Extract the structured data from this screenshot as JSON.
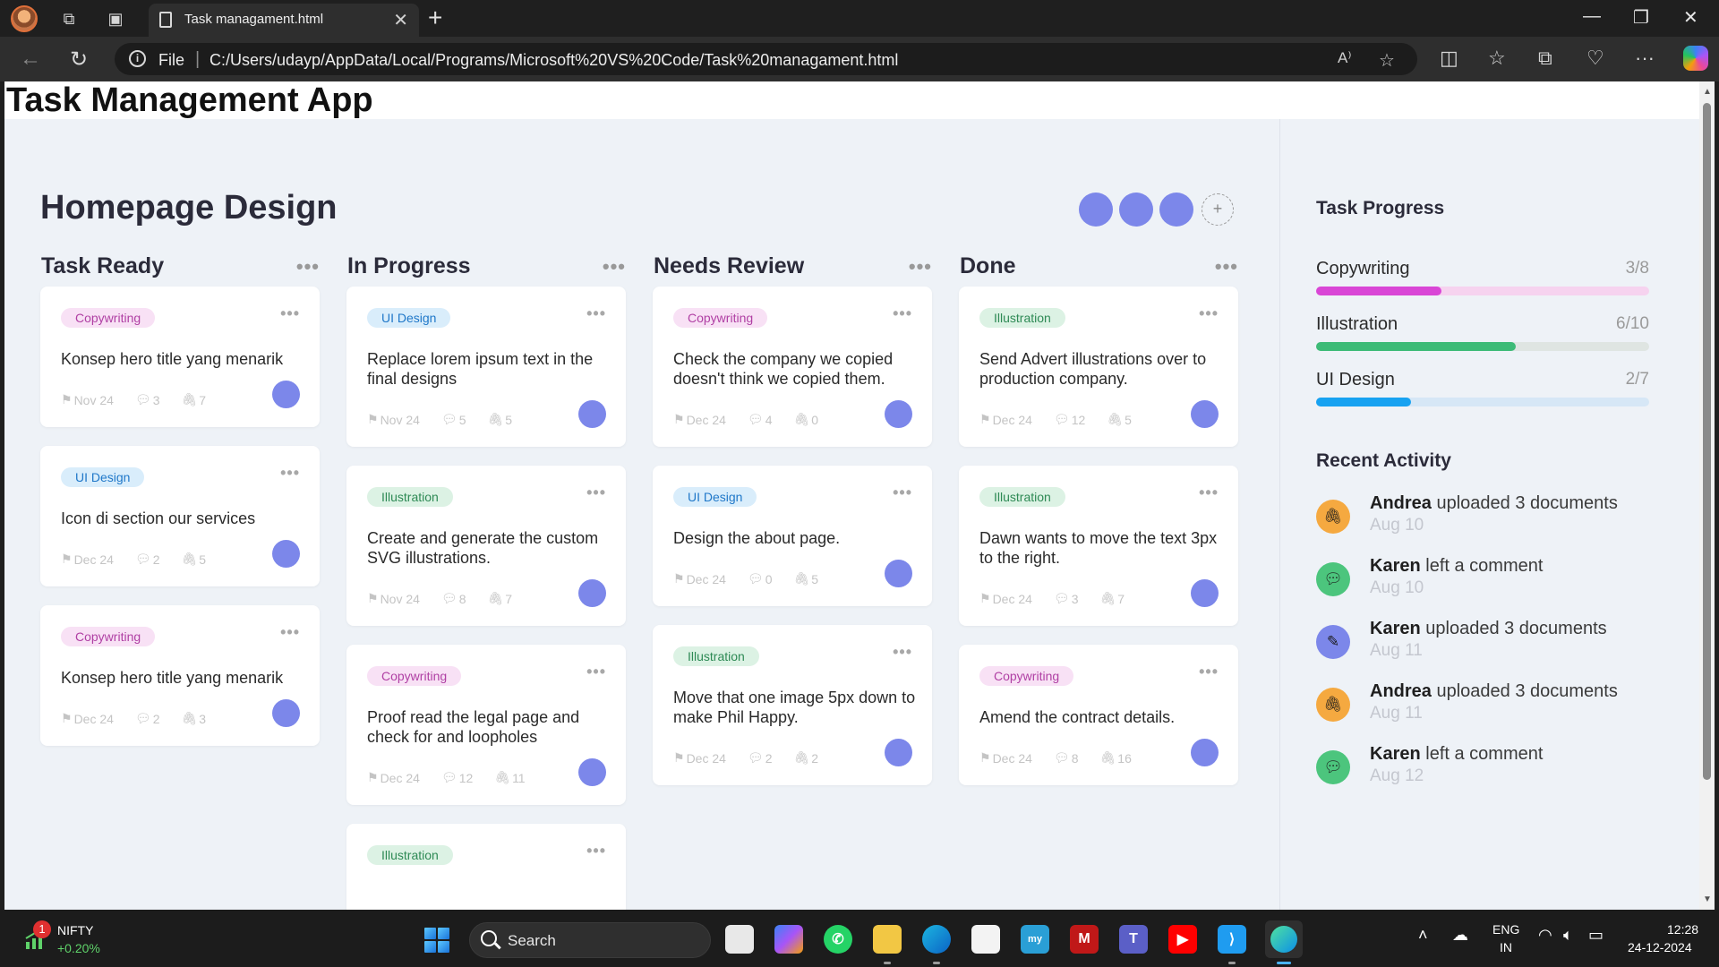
{
  "browser": {
    "tab_title": "Task managament.html",
    "url_scheme": "File",
    "url": "C:/Users/udayp/AppData/Local/Programs/Microsoft%20VS%20Code/Task%20managament.html"
  },
  "page": {
    "app_title": "Task Management App",
    "project_title": "Homepage Design",
    "add_member_label": "+"
  },
  "columns": [
    {
      "title": "Task Ready",
      "cards": [
        {
          "tag": "Copywriting",
          "tag_type": "copy",
          "title": "Konsep hero title yang menarik",
          "date": "Nov 24",
          "comments": "3",
          "attachments": "7"
        },
        {
          "tag": "UI Design",
          "tag_type": "ui",
          "title": "Icon di section our services",
          "date": "Dec 24",
          "comments": "2",
          "attachments": "5"
        },
        {
          "tag": "Copywriting",
          "tag_type": "copy",
          "title": "Konsep hero title yang menarik",
          "date": "Dec 24",
          "comments": "2",
          "attachments": "3"
        }
      ]
    },
    {
      "title": "In Progress",
      "cards": [
        {
          "tag": "UI Design",
          "tag_type": "ui",
          "title": "Replace lorem ipsum text in the final designs",
          "date": "Nov 24",
          "comments": "5",
          "attachments": "5"
        },
        {
          "tag": "Illustration",
          "tag_type": "ill",
          "title": "Create and generate the custom SVG illustrations.",
          "date": "Nov 24",
          "comments": "8",
          "attachments": "7"
        },
        {
          "tag": "Copywriting",
          "tag_type": "copy",
          "title": "Proof read the legal page and check for and loopholes",
          "date": "Dec 24",
          "comments": "12",
          "attachments": "11"
        },
        {
          "tag": "Illustration",
          "tag_type": "ill",
          "title": "",
          "date": "",
          "comments": "",
          "attachments": ""
        }
      ]
    },
    {
      "title": "Needs Review",
      "cards": [
        {
          "tag": "Copywriting",
          "tag_type": "copy",
          "title": "Check the company we copied doesn't think we copied them.",
          "date": "Dec 24",
          "comments": "4",
          "attachments": "0"
        },
        {
          "tag": "UI Design",
          "tag_type": "ui",
          "title": "Design the about page.",
          "date": "Dec 24",
          "comments": "0",
          "attachments": "5"
        },
        {
          "tag": "Illustration",
          "tag_type": "ill",
          "title": "Move that one image 5px down to make Phil Happy.",
          "date": "Dec 24",
          "comments": "2",
          "attachments": "2"
        }
      ]
    },
    {
      "title": "Done",
      "cards": [
        {
          "tag": "Illustration",
          "tag_type": "ill",
          "title": "Send Advert illustrations over to production company.",
          "date": "Dec 24",
          "comments": "12",
          "attachments": "5"
        },
        {
          "tag": "Illustration",
          "tag_type": "ill",
          "title": "Dawn wants to move the text 3px to the right.",
          "date": "Dec 24",
          "comments": "3",
          "attachments": "7"
        },
        {
          "tag": "Copywriting",
          "tag_type": "copy",
          "title": "Amend the contract details.",
          "date": "Dec 24",
          "comments": "8",
          "attachments": "16"
        }
      ]
    }
  ],
  "sidebar": {
    "progress_title": "Task Progress",
    "progress": [
      {
        "label": "Copywriting",
        "count": "3/8",
        "fraction": 0.375,
        "fill": "#d946d6",
        "track": "#f6d3ef"
      },
      {
        "label": "Illustration",
        "count": "6/10",
        "fraction": 0.6,
        "fill": "#3dbb77",
        "track": "#dfe5e2"
      },
      {
        "label": "UI Design",
        "count": "2/7",
        "fraction": 0.286,
        "fill": "#17a2f1",
        "track": "#d6e7f6"
      }
    ],
    "activity_title": "Recent Activity",
    "activity": [
      {
        "user": "Andrea",
        "action": "uploaded 3 documents",
        "date": "Aug 10",
        "icon": "paperclip-icon",
        "color": "#f5a940"
      },
      {
        "user": "Karen",
        "action": "left a comment",
        "date": "Aug 10",
        "icon": "comment-icon",
        "color": "#4cc57d"
      },
      {
        "user": "Karen",
        "action": "uploaded 3 documents",
        "date": "Aug 11",
        "icon": "pencil-icon",
        "color": "#7c87ea"
      },
      {
        "user": "Andrea",
        "action": "uploaded 3 documents",
        "date": "Aug 11",
        "icon": "paperclip-icon",
        "color": "#f5a940"
      },
      {
        "user": "Karen",
        "action": "left a comment",
        "date": "Aug 12",
        "icon": "comment-icon",
        "color": "#4cc57d"
      }
    ]
  },
  "taskbar": {
    "ticker_name": "NIFTY",
    "ticker_change": "+0.20%",
    "notification_count": "1",
    "search_label": "Search",
    "lang_line1": "ENG",
    "lang_line2": "IN",
    "time": "12:28",
    "date": "24-12-2024"
  }
}
